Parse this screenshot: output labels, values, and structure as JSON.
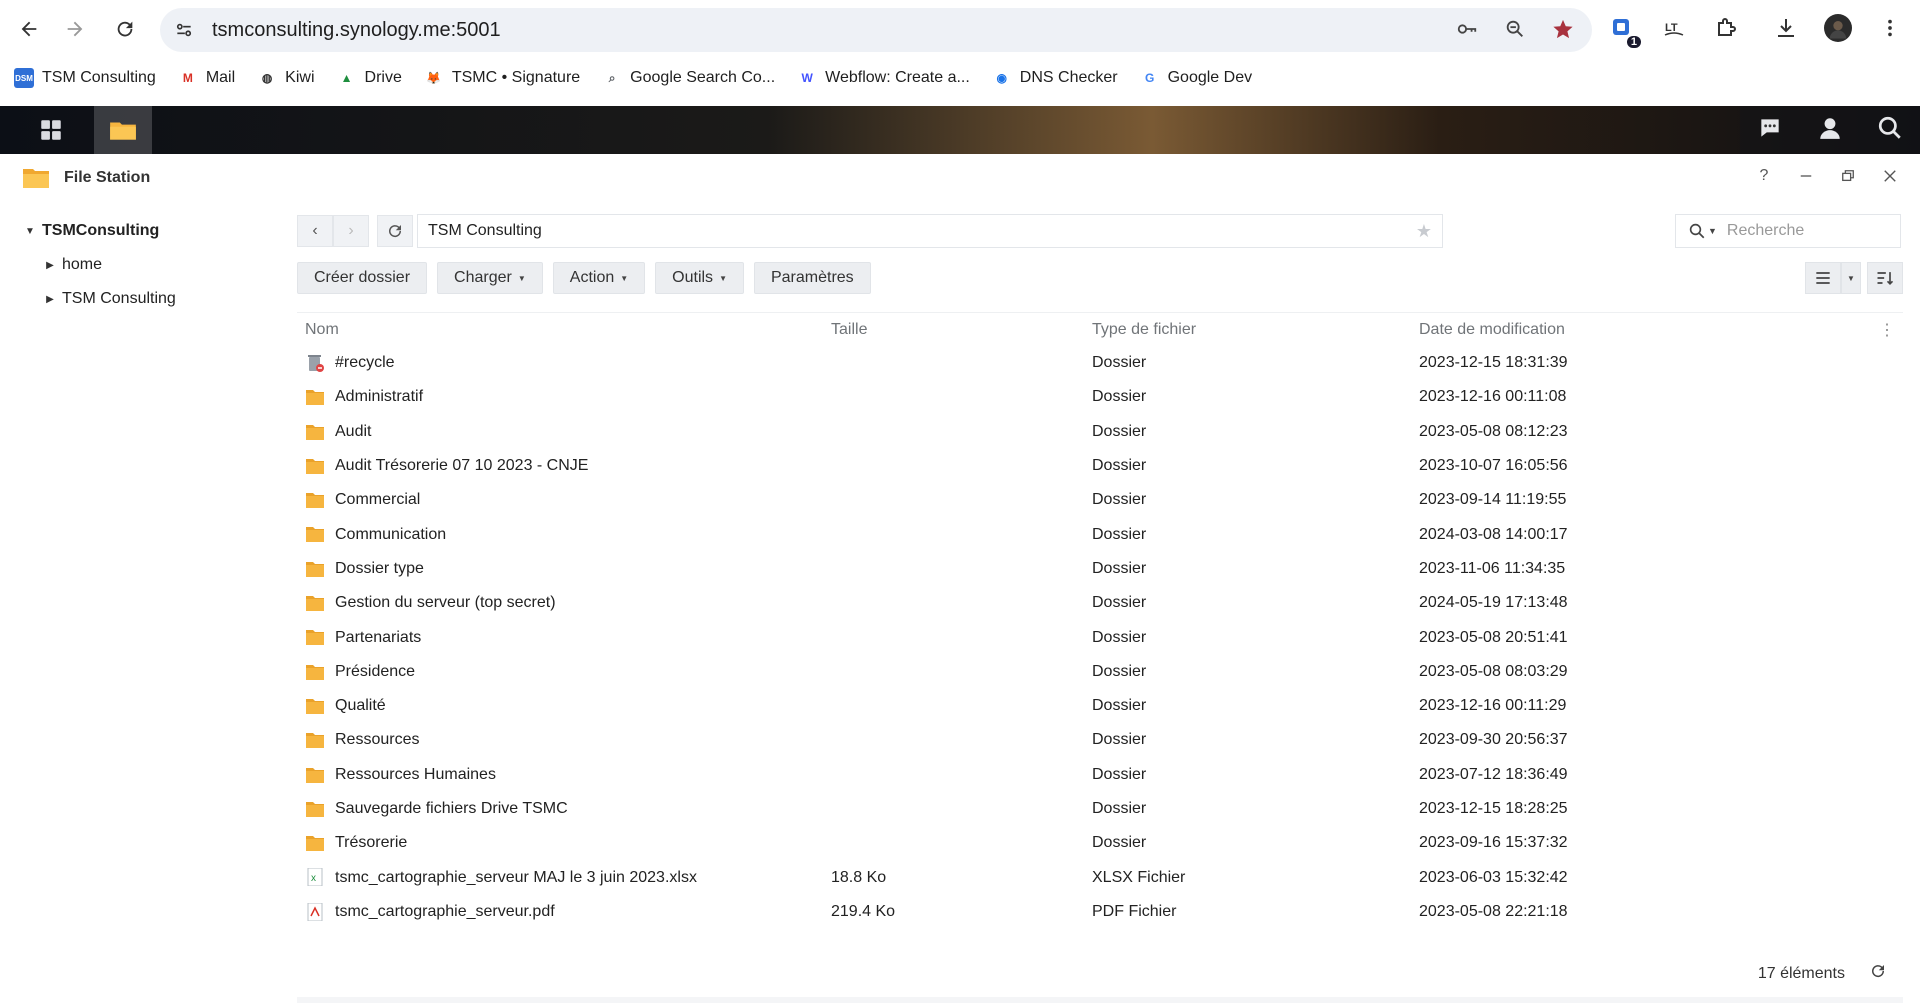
{
  "browser": {
    "url": "tsmconsulting.synology.me:5001",
    "bookmarks": [
      {
        "label": "TSM Consulting",
        "icon": "dsm-icon",
        "color": "#2f6fd6"
      },
      {
        "label": "Mail",
        "icon": "gmail-icon",
        "color": "#d93025"
      },
      {
        "label": "Kiwi",
        "icon": "globe-icon",
        "color": "#333333"
      },
      {
        "label": "Drive",
        "icon": "drive-icon",
        "color": "#1e8e3e"
      },
      {
        "label": "TSMC • Signature",
        "icon": "fox-icon",
        "color": "#e8710a"
      },
      {
        "label": "Google Search Co...",
        "icon": "search-console-icon",
        "color": "#5f6368"
      },
      {
        "label": "Webflow: Create a...",
        "icon": "webflow-icon",
        "color": "#4353ff"
      },
      {
        "label": "DNS Checker",
        "icon": "dns-icon",
        "color": "#1a73e8"
      },
      {
        "label": "Google Dev",
        "icon": "google-icon",
        "color": "#4285f4"
      }
    ],
    "extension_badge": "1"
  },
  "window": {
    "title": "File Station",
    "controls": [
      "?",
      "minimize",
      "restore",
      "close"
    ]
  },
  "tree": {
    "root": "TSMConsulting",
    "children": [
      "home",
      "TSM Consulting"
    ]
  },
  "path": "TSM Consulting",
  "search_placeholder": "Recherche",
  "toolbar": {
    "create_folder": "Créer dossier",
    "upload": "Charger",
    "action": "Action",
    "tools": "Outils",
    "settings": "Paramètres"
  },
  "columns": {
    "name": "Nom",
    "size": "Taille",
    "type": "Type de fichier",
    "date": "Date de modification"
  },
  "files": [
    {
      "name": "#recycle",
      "size": "",
      "type": "Dossier",
      "date": "2023-12-15 18:31:39",
      "icon": "recycle-bin-icon"
    },
    {
      "name": "Administratif",
      "size": "",
      "type": "Dossier",
      "date": "2023-12-16 00:11:08",
      "icon": "folder-icon"
    },
    {
      "name": "Audit",
      "size": "",
      "type": "Dossier",
      "date": "2023-05-08 08:12:23",
      "icon": "folder-icon"
    },
    {
      "name": "Audit Trésorerie 07 10 2023 - CNJE",
      "size": "",
      "type": "Dossier",
      "date": "2023-10-07 16:05:56",
      "icon": "folder-icon"
    },
    {
      "name": "Commercial",
      "size": "",
      "type": "Dossier",
      "date": "2023-09-14 11:19:55",
      "icon": "folder-icon"
    },
    {
      "name": "Communication",
      "size": "",
      "type": "Dossier",
      "date": "2024-03-08 14:00:17",
      "icon": "folder-icon"
    },
    {
      "name": "Dossier type",
      "size": "",
      "type": "Dossier",
      "date": "2023-11-06 11:34:35",
      "icon": "folder-icon"
    },
    {
      "name": "Gestion du serveur (top secret)",
      "size": "",
      "type": "Dossier",
      "date": "2024-05-19 17:13:48",
      "icon": "folder-icon"
    },
    {
      "name": "Partenariats",
      "size": "",
      "type": "Dossier",
      "date": "2023-05-08 20:51:41",
      "icon": "folder-icon"
    },
    {
      "name": "Présidence",
      "size": "",
      "type": "Dossier",
      "date": "2023-05-08 08:03:29",
      "icon": "folder-icon"
    },
    {
      "name": "Qualité",
      "size": "",
      "type": "Dossier",
      "date": "2023-12-16 00:11:29",
      "icon": "folder-icon"
    },
    {
      "name": "Ressources",
      "size": "",
      "type": "Dossier",
      "date": "2023-09-30 20:56:37",
      "icon": "folder-icon"
    },
    {
      "name": "Ressources Humaines",
      "size": "",
      "type": "Dossier",
      "date": "2023-07-12 18:36:49",
      "icon": "folder-icon"
    },
    {
      "name": "Sauvegarde fichiers Drive TSMC",
      "size": "",
      "type": "Dossier",
      "date": "2023-12-15 18:28:25",
      "icon": "folder-icon"
    },
    {
      "name": "Trésorerie",
      "size": "",
      "type": "Dossier",
      "date": "2023-09-16 15:37:32",
      "icon": "folder-icon"
    },
    {
      "name": "tsmc_cartographie_serveur MAJ le 3 juin 2023.xlsx",
      "size": "18.8 Ko",
      "type": "XLSX Fichier",
      "date": "2023-06-03 15:32:42",
      "icon": "xlsx-file-icon"
    },
    {
      "name": "tsmc_cartographie_serveur.pdf",
      "size": "219.4 Ko",
      "type": "PDF Fichier",
      "date": "2023-05-08 22:21:18",
      "icon": "pdf-file-icon"
    }
  ],
  "status": {
    "count": "17 éléments"
  },
  "colors": {
    "folder": "#f6b53f",
    "accent": "#2f6fd6"
  }
}
